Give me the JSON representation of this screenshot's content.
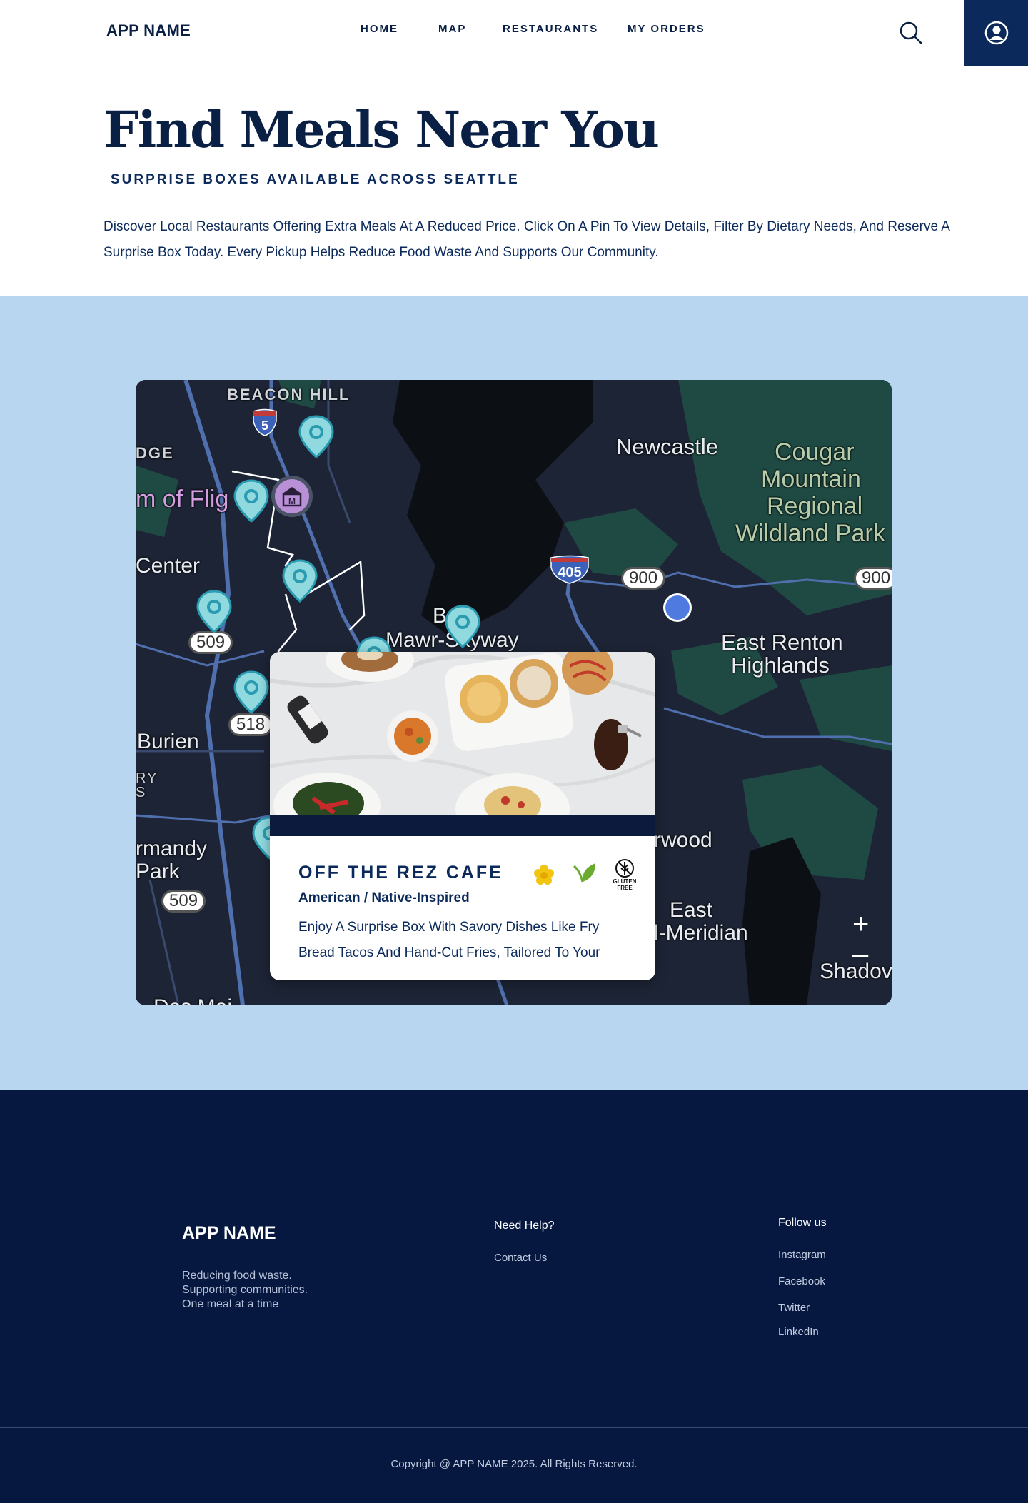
{
  "nav": {
    "brand": "APP NAME",
    "items": [
      "HOME",
      "MAP",
      "RESTAURANTS",
      "MY ORDERS"
    ],
    "search_icon": "search-icon",
    "profile_icon": "user-circle-icon"
  },
  "hero": {
    "title": "Find Meals Near You",
    "subtitle": "SURPRISE BOXES AVAILABLE ACROSS SEATTLE",
    "description": "Discover Local Restaurants Offering Extra Meals At A Reduced Price. Click On A Pin To View Details, Filter By Dietary Needs, And Reserve A Surprise Box Today. Every Pickup Helps Reduce Food Waste And Supports Our Community."
  },
  "map": {
    "labels": {
      "beacon_hill": "BEACON HILL",
      "dge": "DGE",
      "museum": "m of Flig",
      "center": "Center",
      "burien": "Burien",
      "ry": "RY",
      "ry2": "S",
      "normandy": "rmandy",
      "park": "Park",
      "des_moines": "Des Moi",
      "newcastle": "Newcastle",
      "cougar": "Cougar",
      "mountain": "Mountain",
      "regional": "Regional",
      "wildland": "Wildland Park",
      "bryn_b": "B",
      "bryn": "Mawr-Skyway",
      "east_renton": "East Renton",
      "highlands": "Highlands",
      "fairwood": "rwood",
      "east": "East",
      "meridian": "l-Meridian",
      "shadow": "Shadov"
    },
    "route_badges": [
      "509",
      "518",
      "509",
      "900",
      "900"
    ],
    "interstates": [
      "5",
      "405"
    ],
    "zoom_in": "+",
    "zoom_out": "–",
    "colors": {
      "water": "#0c0f14",
      "land": "#1d2435",
      "park": "#1f4a44",
      "road": "#4f6fae",
      "pin": "#8fd9df",
      "pin_stroke": "#2a9bb0",
      "user_dot": "#4f7be0"
    }
  },
  "card": {
    "name": "OFF THE REZ CAFE",
    "cuisine": "American / Native-Inspired",
    "description": "Enjoy A Surprise Box With Savory Dishes Like Fry Bread Tacos And Hand-Cut Fries, Tailored To Your",
    "diet_icons": [
      "flower-icon",
      "vegan-leaf-icon",
      "gluten-free-icon"
    ],
    "gf_label_1": "GLUTEN",
    "gf_label_2": "FREE"
  },
  "footer": {
    "brand": "APP NAME",
    "tagline_1": "Reducing food waste.",
    "tagline_2": "Supporting communities.",
    "tagline_3": "One meal at a time",
    "help_heading": "Need Help?",
    "help_links": [
      "Contact Us"
    ],
    "follow_heading": "Follow us",
    "social_links": [
      "Instagram",
      "Facebook",
      "Twitter",
      "LinkedIn"
    ],
    "copyright": "Copyright @ APP NAME 2025. All Rights Reserved."
  }
}
